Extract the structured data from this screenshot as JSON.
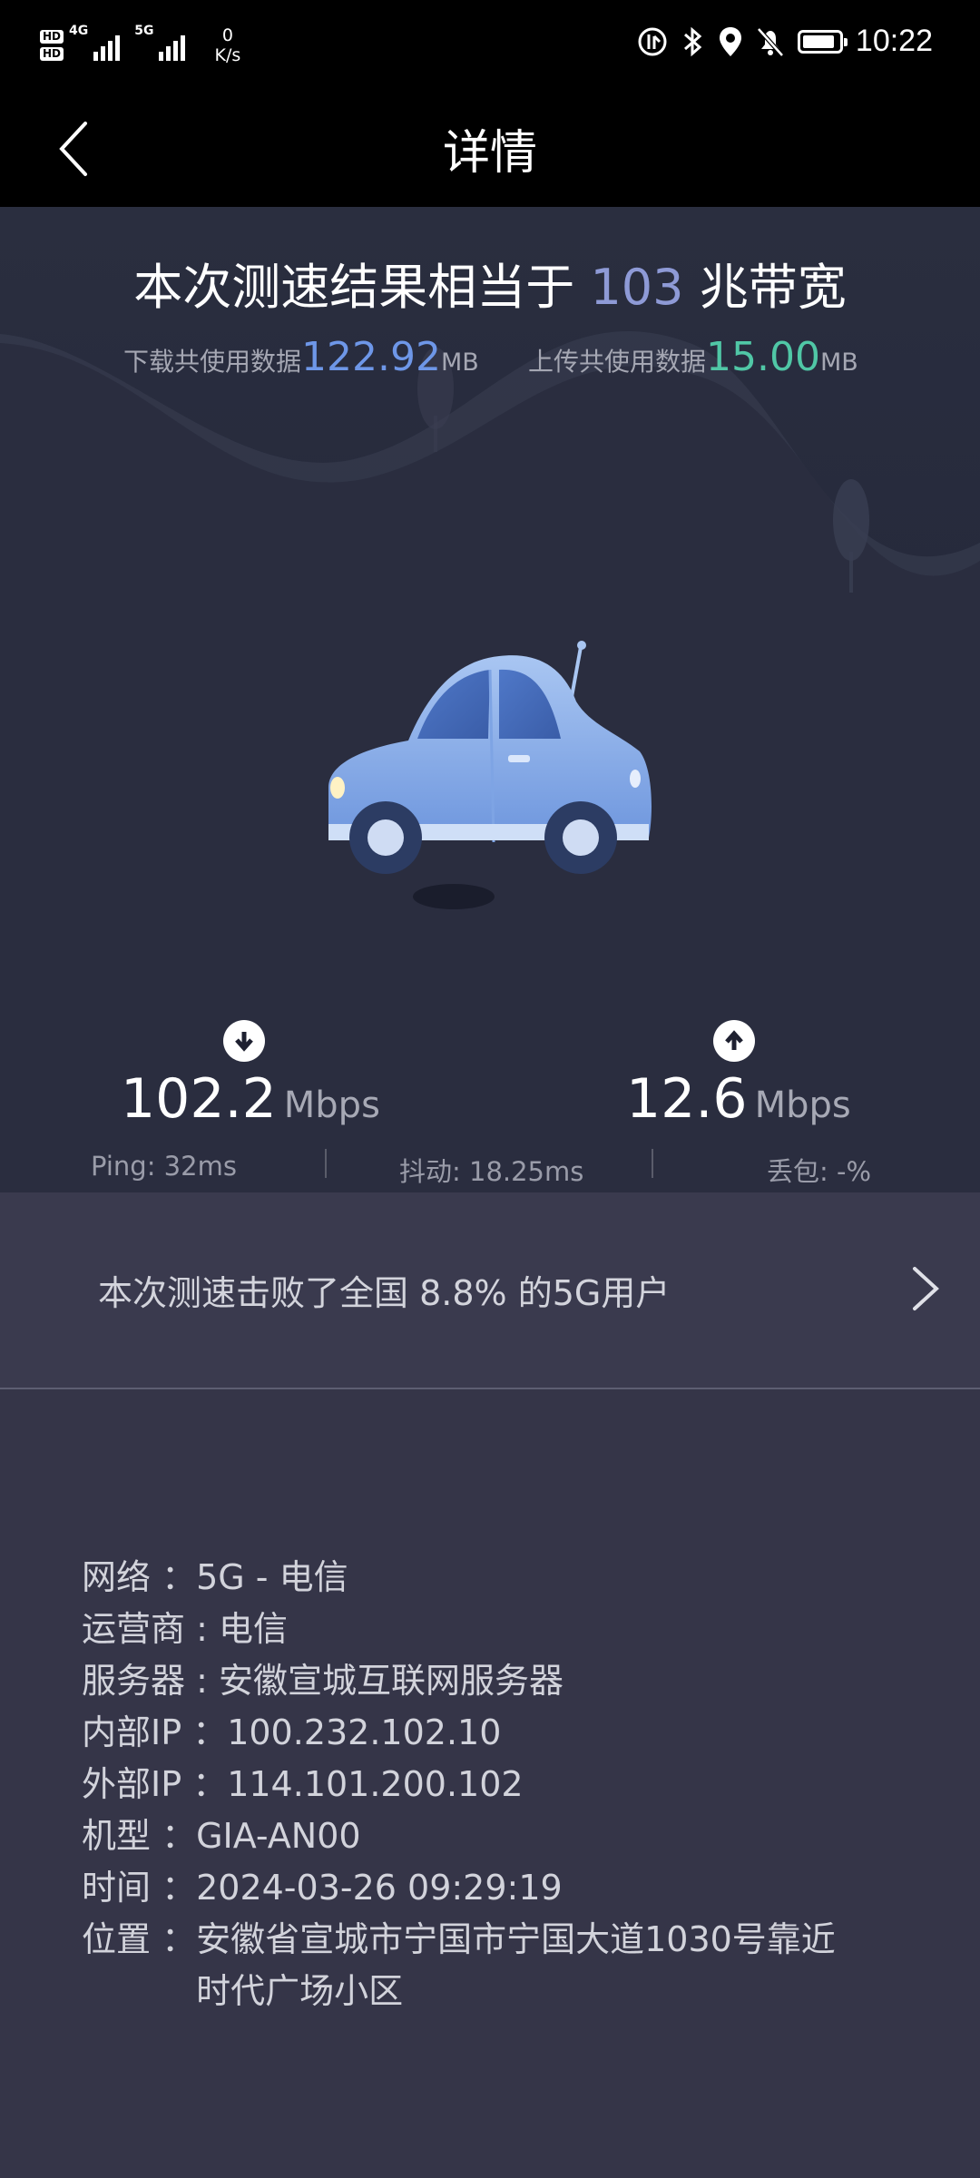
{
  "status_bar": {
    "hd1": "HD",
    "hd2": "HD",
    "net1": "4G",
    "net2": "5G",
    "speed_value": "0",
    "speed_unit": "K/s",
    "time": "10:22",
    "battery_level_fraction": 0.9
  },
  "header": {
    "title": "详情"
  },
  "result": {
    "bandwidth_prefix": "本次测速结果相当于 ",
    "bandwidth_value": "103",
    "bandwidth_suffix": " 兆带宽",
    "download_usage_label": "下载共使用数据",
    "download_usage_value": "122.92",
    "download_usage_unit": "MB",
    "upload_usage_label": "上传共使用数据",
    "upload_usage_value": "15.00",
    "upload_usage_unit": "MB",
    "download_speed": "102.2",
    "download_unit": "Mbps",
    "upload_speed": "12.6",
    "upload_unit": "Mbps",
    "ping": "Ping:  32ms",
    "jitter": "抖动:  18.25ms",
    "packet_loss": "丢包:  -%"
  },
  "beat": {
    "text": "本次测速击败了全国 8.8% 的5G用户"
  },
  "info": {
    "network_key": "网络 ：",
    "network_value": "5G - 电信",
    "carrier_key": "运营商 : ",
    "carrier_value": "电信",
    "server_key": "服务器 : ",
    "server_value": "安徽宣城互联网服务器",
    "internal_ip_key": "内部IP ：",
    "internal_ip_value": "100.232.102.10",
    "external_ip_key": "外部IP ：",
    "external_ip_value": "114.101.200.102",
    "model_key": "机型 ：",
    "model_value": "GIA-AN00",
    "time_key": "时间 ：",
    "time_value": "2024-03-26 09:29:19",
    "location_key": "位置 ：",
    "location_value": "安徽省宣城市宁国市宁国大道1030号靠近时代广场小区"
  },
  "colors": {
    "download_accent": "#6e97e8",
    "upload_accent": "#50c7a6",
    "bandwidth_accent": "#8e9ad6"
  }
}
